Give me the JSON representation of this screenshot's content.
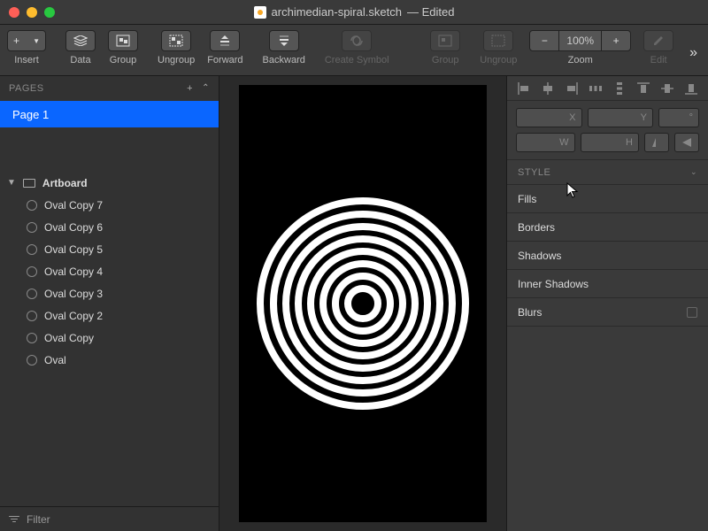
{
  "title": {
    "filename": "archimedian-spiral.sketch",
    "status": "Edited"
  },
  "toolbar": {
    "insert": "Insert",
    "data": "Data",
    "group": "Group",
    "ungroup": "Ungroup",
    "forward": "Forward",
    "backward": "Backward",
    "create_symbol": "Create Symbol",
    "group2": "Group",
    "ungroup2": "Ungroup",
    "zoom_label": "Zoom",
    "zoom_value": "100%",
    "edit": "Edit"
  },
  "pages": {
    "header": "PAGES",
    "items": [
      {
        "name": "Page 1"
      }
    ]
  },
  "layers": {
    "artboard": "Artboard",
    "items": [
      {
        "name": "Oval Copy 7"
      },
      {
        "name": "Oval Copy 6"
      },
      {
        "name": "Oval Copy 5"
      },
      {
        "name": "Oval Copy 4"
      },
      {
        "name": "Oval Copy 3"
      },
      {
        "name": "Oval Copy 2"
      },
      {
        "name": "Oval Copy"
      },
      {
        "name": "Oval"
      }
    ]
  },
  "filter": {
    "label": "Filter"
  },
  "inspector": {
    "x": "X",
    "y": "Y",
    "angle": "°",
    "w": "W",
    "h": "H",
    "style_header": "STYLE",
    "sections": {
      "fills": "Fills",
      "borders": "Borders",
      "shadows": "Shadows",
      "inner_shadows": "Inner Shadows",
      "blurs": "Blurs"
    }
  },
  "rings": [
    240,
    210,
    182,
    154,
    126,
    98,
    70,
    42
  ]
}
